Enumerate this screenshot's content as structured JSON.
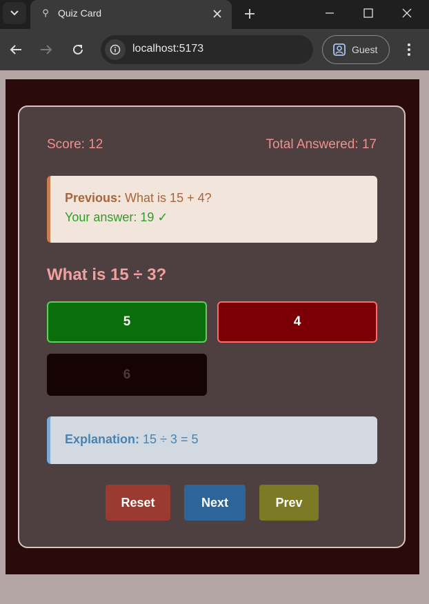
{
  "browser": {
    "tab_title": "Quiz Card",
    "url": "localhost:5173",
    "profile_label": "Guest"
  },
  "quiz": {
    "score_text": "Score: 12",
    "total_text": "Total Answered: 17",
    "previous": {
      "label": "Previous:",
      "question": "What is 15 + 4?",
      "answer_text": "Your answer: 19 ✓"
    },
    "question": "What is 15 ÷ 3?",
    "options": [
      {
        "label": "5",
        "state": "correct"
      },
      {
        "label": "4",
        "state": "wrong"
      },
      {
        "label": "6",
        "state": "neutral"
      }
    ],
    "explanation": {
      "label": "Explanation:",
      "text": "15 ÷ 3 = 5"
    },
    "buttons": {
      "reset": "Reset",
      "next": "Next",
      "prev": "Prev"
    }
  },
  "colors": {
    "card_bg": "#4e4040",
    "accent_text": "#ef8f8f",
    "correct": "#0a6e0a",
    "wrong": "#7a0006",
    "reset": "#9a3a31",
    "next": "#2d6598",
    "prev": "#7d7a25"
  }
}
